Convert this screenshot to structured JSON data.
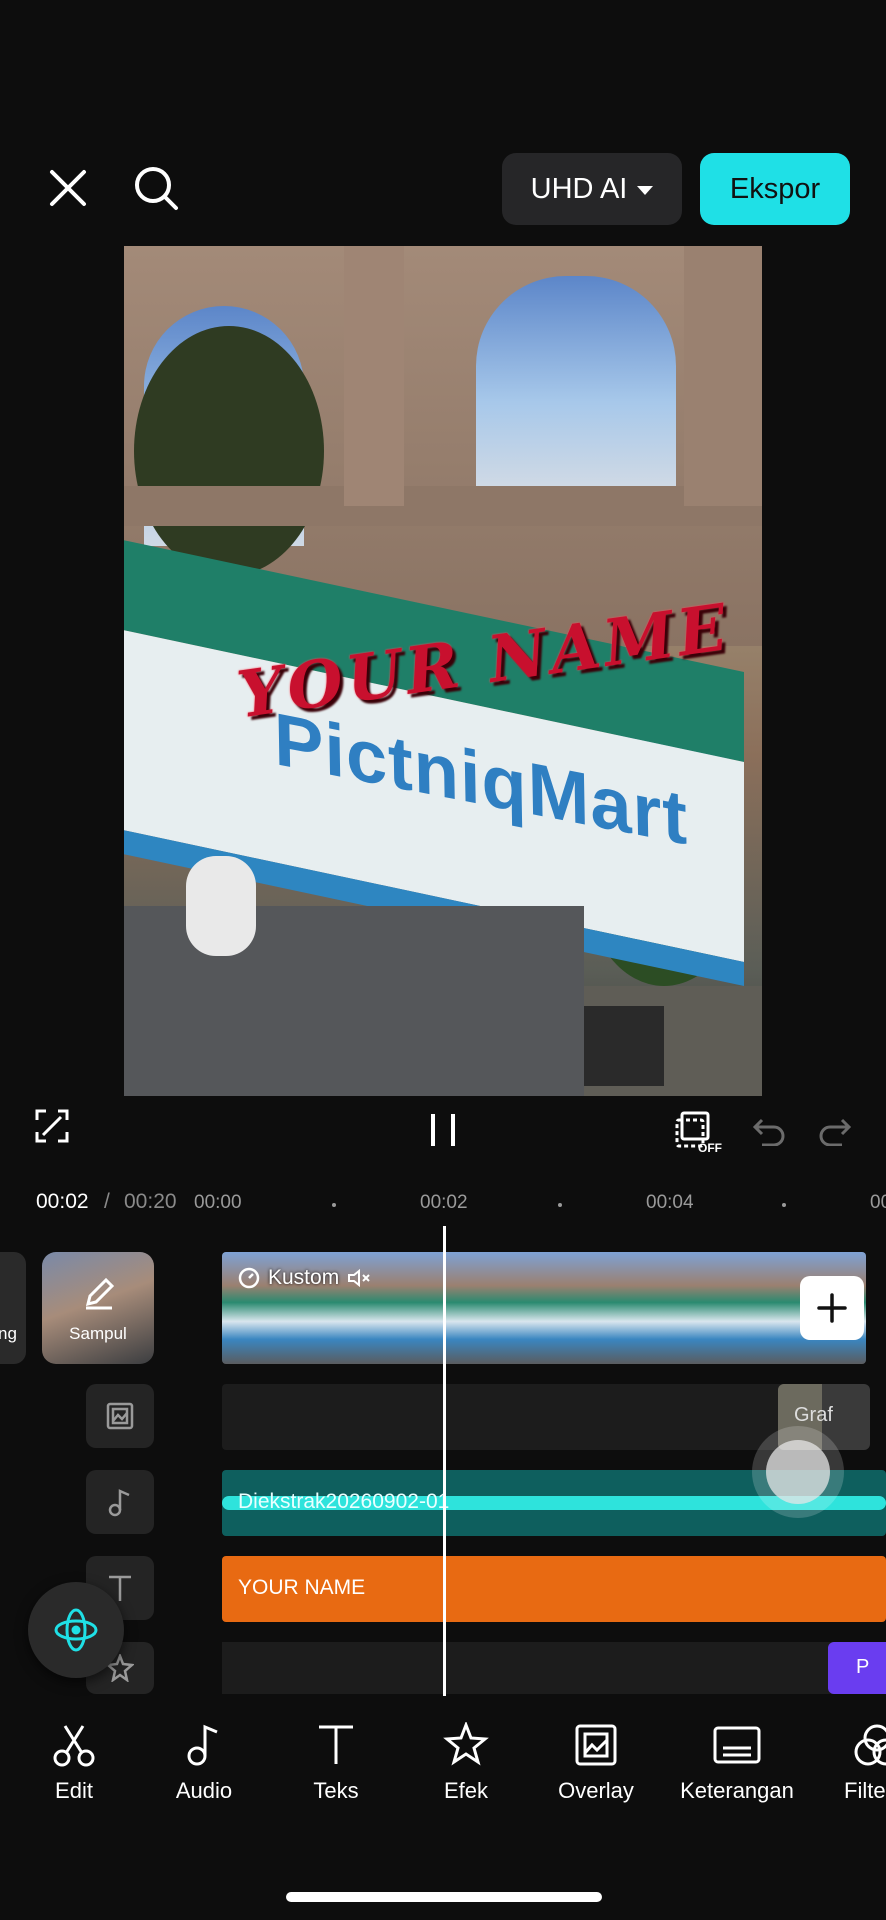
{
  "top_bar": {
    "quality_label": "UHD AI",
    "export_label": "Ekspor"
  },
  "preview": {
    "overlay_text": "YOUR NAME",
    "store_sign": "PictniqMart"
  },
  "timeline": {
    "current_time": "00:02",
    "separator": "/",
    "total_time": "00:20",
    "ticks": [
      "00:00",
      "00:02",
      "00:04",
      "00"
    ],
    "cover_label": "Sampul",
    "left_partial_label": "ng",
    "video_clip_label": "Kustom",
    "overlay_clip_label": "Graf",
    "audio_clip_label": "Diekstrak20260902-01",
    "text_clip_label": "YOUR NAME",
    "effect_clip_label": "P"
  },
  "toolbar": {
    "items": [
      {
        "label": "Edit",
        "icon": "scissors-icon"
      },
      {
        "label": "Audio",
        "icon": "music-note-icon"
      },
      {
        "label": "Teks",
        "icon": "text-icon"
      },
      {
        "label": "Efek",
        "icon": "star-icon"
      },
      {
        "label": "Overlay",
        "icon": "overlay-icon"
      },
      {
        "label": "Keterangan",
        "icon": "captions-icon"
      },
      {
        "label": "Filte",
        "icon": "filter-icon"
      }
    ]
  },
  "colors": {
    "accent": "#1fe0e6",
    "text_track": "#e86a12",
    "audio_track": "#0e5f5e",
    "effect_track": "#6a3df0"
  }
}
